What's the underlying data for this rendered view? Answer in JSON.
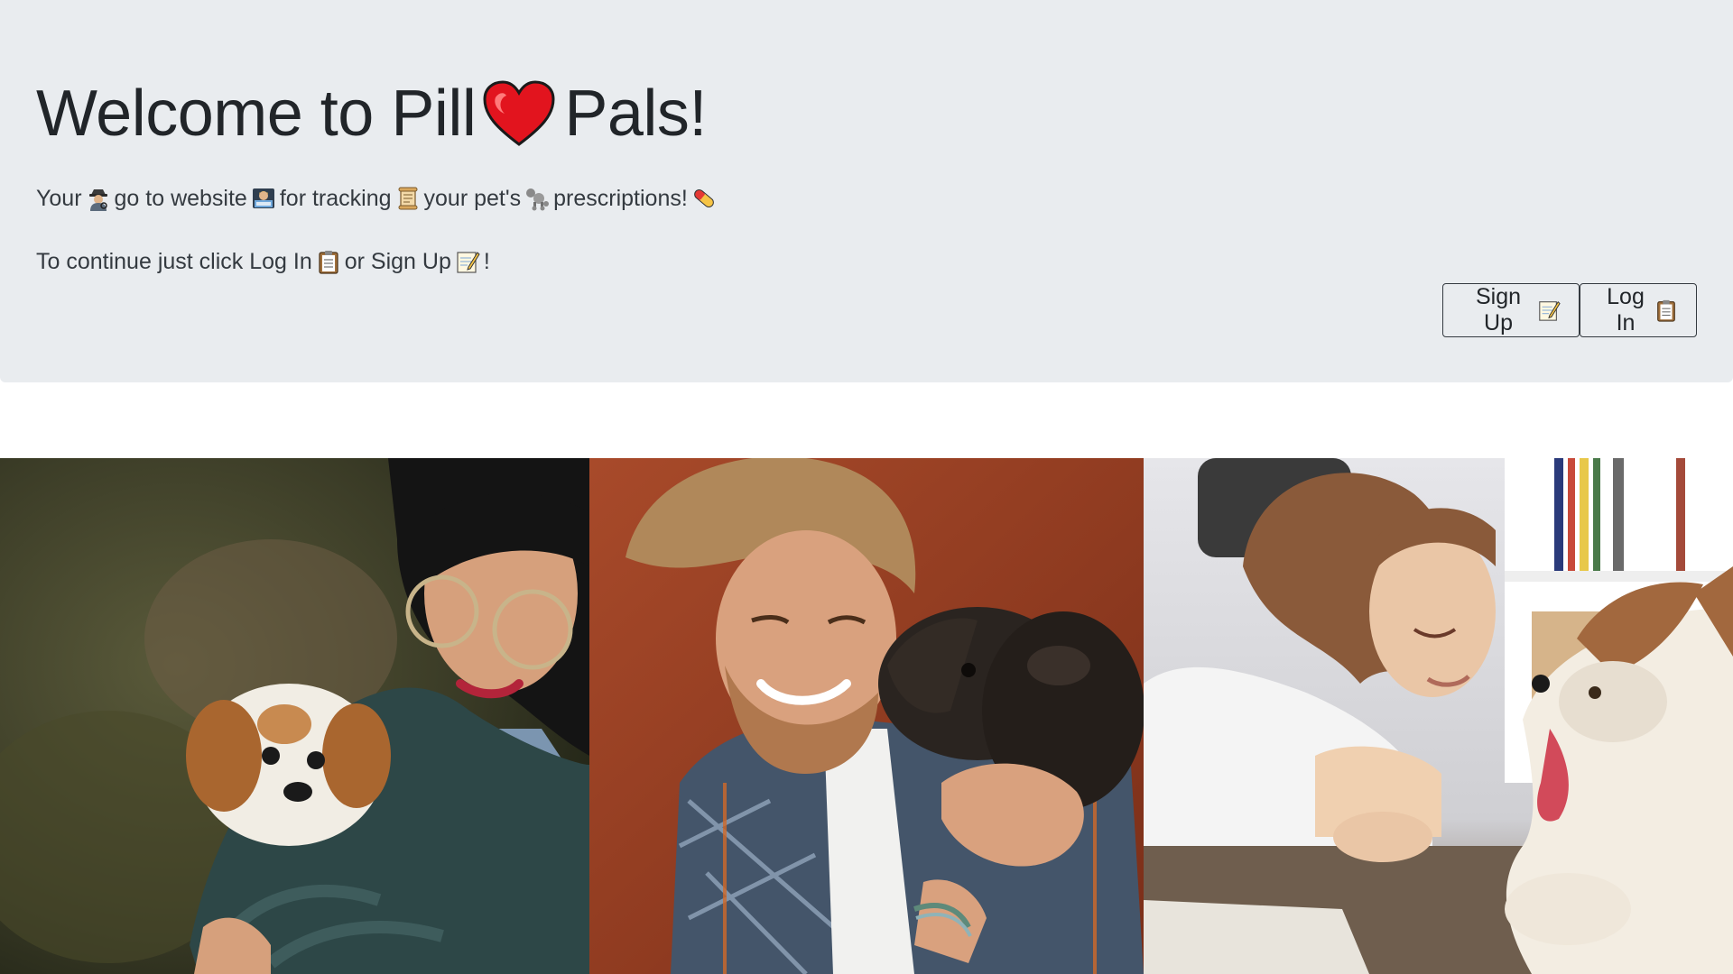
{
  "hero": {
    "title_prefix": "Welcome to Pill",
    "title_icon": "heart-icon",
    "title_suffix": "Pals!",
    "tagline": {
      "w1": "Your",
      "w2": "go to website",
      "w3": "for tracking",
      "w4": "your pet's",
      "w5": "prescriptions!"
    },
    "instruction": {
      "w1": "To continue just click Log In",
      "w2": "or Sign Up",
      "w3": "!"
    },
    "colors": {
      "background": "#e9ecef",
      "heart": "#e2141e",
      "text": "#212529"
    }
  },
  "buttons": {
    "signup_label": "Sign Up",
    "signup_icon": "memo-icon",
    "login_label": "Log In",
    "login_icon": "clipboard-icon"
  },
  "photos": [
    {
      "name": "woman-with-shih-tzu-photo"
    },
    {
      "name": "man-with-dog-photo"
    },
    {
      "name": "woman-with-husky-photo"
    }
  ]
}
